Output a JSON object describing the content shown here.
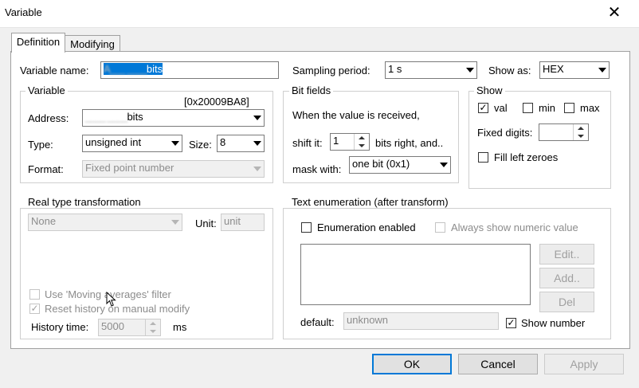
{
  "window": {
    "title": "Variable",
    "close_glyph": "✕"
  },
  "tabs": [
    {
      "label": "Definition"
    },
    {
      "label": "Modifying"
    }
  ],
  "definition": {
    "variable_name_label": "Variable name:",
    "variable_name_blurred_prefix": "A___ ____",
    "variable_name_suffix": "bits",
    "sampling_period_label": "Sampling period:",
    "sampling_period_value": "1 s",
    "show_as_label": "Show as:",
    "show_as_value": "HEX",
    "variable_group": {
      "label": "Variable",
      "address_hex": "[0x20009BA8]",
      "address_label": "Address:",
      "address_blurred_prefix": "____ ____",
      "address_suffix": "bits",
      "type_label": "Type:",
      "type_value": "unsigned int",
      "size_label": "Size:",
      "size_value": "8",
      "format_label": "Format:",
      "format_value": "Fixed point number"
    },
    "bitfields_group": {
      "label": "Bit fields",
      "info": "When the value is received,",
      "shift_label": "shift it:",
      "shift_value": "1",
      "shift_suffix": "bits right, and..",
      "mask_label": "mask with:",
      "mask_value": "one bit (0x1)"
    },
    "show_group": {
      "label": "Show",
      "val_label": "val",
      "val_checked": "✓",
      "min_label": "min",
      "max_label": "max",
      "fixed_digits_label": "Fixed digits:",
      "fixed_digits_value": "",
      "fill_zeroes_label": "Fill left zeroes"
    },
    "real_type_group": {
      "label": "Real type transformation",
      "type_value": "None",
      "unit_label": "Unit:",
      "unit_placeholder": "unit",
      "moving_avg_label": "Use 'Moving averages' filter",
      "reset_history_label": "Reset history on manual modify",
      "reset_history_checked": "✓",
      "history_time_label": "History time:",
      "history_time_value": "5000",
      "history_time_unit": "ms"
    },
    "text_enum_group": {
      "label": "Text enumeration (after transform)",
      "enum_enabled_label": "Enumeration enabled",
      "always_numeric_label": "Always show numeric value",
      "edit_label": "Edit..",
      "add_label": "Add..",
      "del_label": "Del",
      "default_label": "default:",
      "default_value": "unknown",
      "show_number_label": "Show number",
      "show_number_checked": "✓"
    }
  },
  "footer": {
    "ok_label": "OK",
    "cancel_label": "Cancel",
    "apply_label": "Apply"
  }
}
